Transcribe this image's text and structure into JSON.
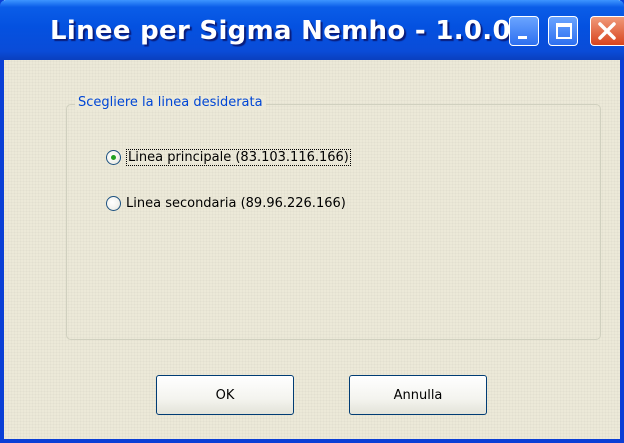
{
  "window": {
    "title": "Linee per Sigma Nemho - 1.0.0",
    "controls": {
      "minimize": "minimize-icon",
      "maximize": "maximize-icon",
      "close": "close-icon"
    }
  },
  "group": {
    "legend": "Scegliere la linea desiderata",
    "options": [
      {
        "label": "Linea principale (83.103.116.166)",
        "checked": true
      },
      {
        "label": "Linea secondaria (89.96.226.166)",
        "checked": false
      }
    ]
  },
  "buttons": {
    "ok": "OK",
    "cancel": "Annulla"
  },
  "colors": {
    "titlebar": "#0451e0",
    "frame": "#0a3fd6",
    "dialog_bg": "#ece9d8",
    "legend_text": "#0046d5",
    "radio_dot": "#21a121",
    "close_button": "#d8441e"
  }
}
